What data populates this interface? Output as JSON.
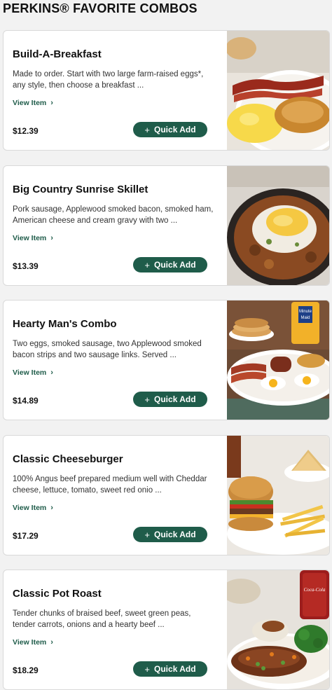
{
  "header": {
    "title": "PERKINS® FAVORITE COMBOS"
  },
  "items": [
    {
      "name": "Build-A-Breakfast",
      "description": "Made to order. Start with two large farm-raised eggs*, any style, then choose a breakfast ...",
      "view_label": "View Item",
      "price": "$12.39",
      "quick_add_label": "Quick Add"
    },
    {
      "name": "Big Country Sunrise Skillet",
      "description": "Pork sausage, Applewood smoked bacon, smoked ham, American cheese and cream gravy with two ...",
      "view_label": "View Item",
      "price": "$13.39",
      "quick_add_label": "Quick Add"
    },
    {
      "name": "Hearty Man's Combo",
      "description": "Two eggs, smoked sausage, two Applewood smoked bacon strips and two sausage links. Served ...",
      "view_label": "View Item",
      "price": "$14.89",
      "quick_add_label": "Quick Add",
      "photo_text": {
        "line1": "Minute",
        "line2": "Maid"
      }
    },
    {
      "name": "Classic Cheeseburger",
      "description": "100% Angus beef prepared medium well with Cheddar cheese, lettuce, tomato, sweet red onio ...",
      "view_label": "View Item",
      "price": "$17.29",
      "quick_add_label": "Quick Add"
    },
    {
      "name": "Classic Pot Roast",
      "description": "Tender chunks of braised beef, sweet green peas, tender carrots, onions and a hearty beef ...",
      "view_label": "View Item",
      "price": "$18.29",
      "quick_add_label": "Quick Add",
      "photo_text": {
        "line1": "Coca-Cola"
      }
    }
  ],
  "colors": {
    "accent": "#1f5c4a",
    "background": "#f2f2f2",
    "card": "#ffffff"
  },
  "icons": {
    "view_chevron": "chevron-right-icon",
    "quick_add": "plus-icon"
  }
}
